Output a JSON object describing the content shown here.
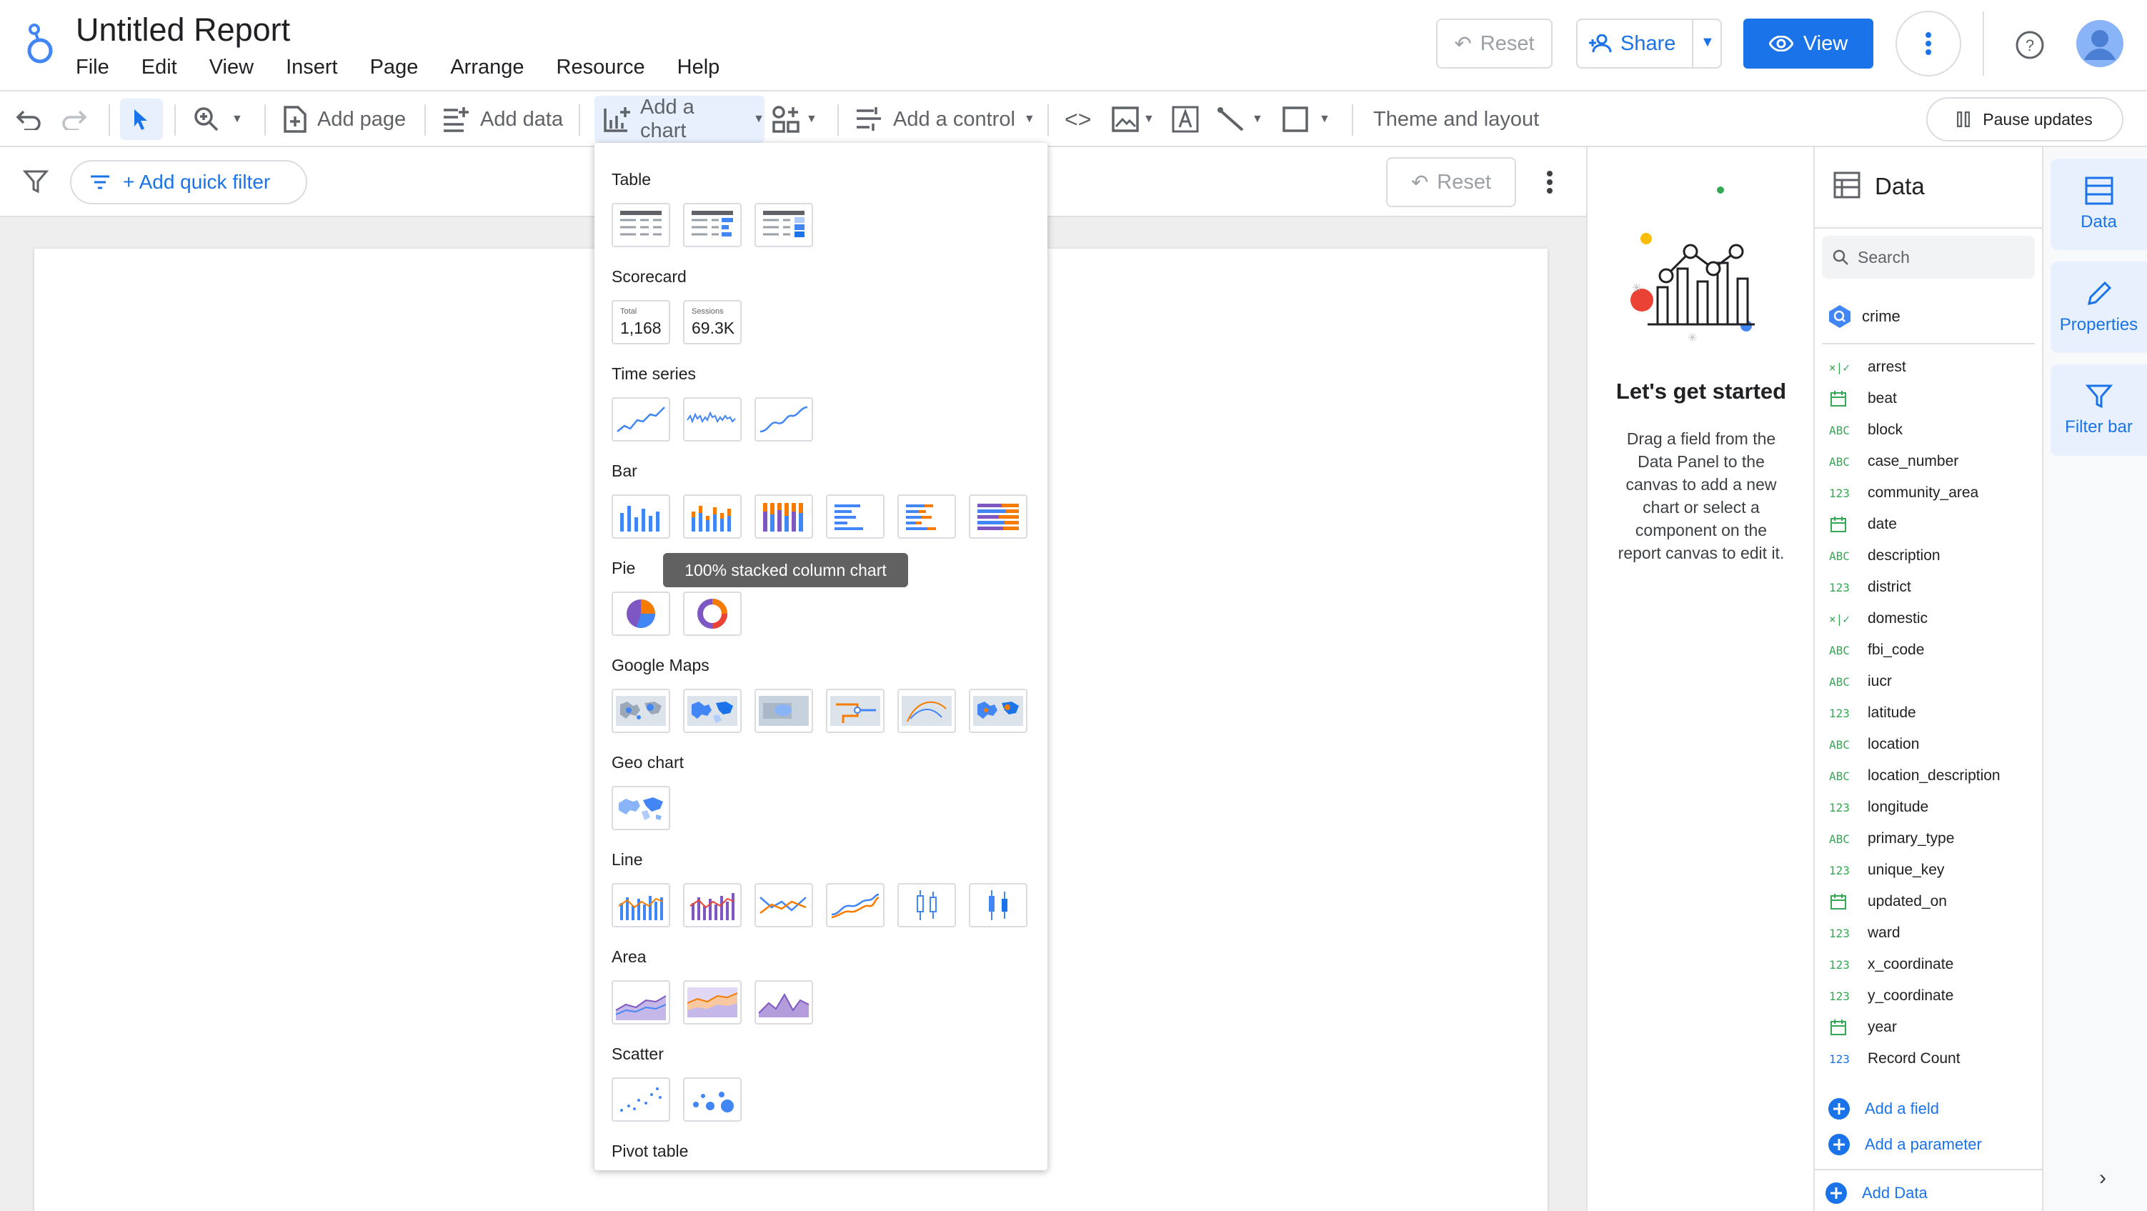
{
  "app": {
    "title": "Untitled Report"
  },
  "menu": [
    "File",
    "Edit",
    "View",
    "Insert",
    "Page",
    "Arrange",
    "Resource",
    "Help"
  ],
  "header_buttons": {
    "reset": "Reset",
    "share": "Share",
    "view": "View"
  },
  "toolbar": {
    "add_page": "Add page",
    "add_data": "Add data",
    "add_chart": "Add a chart",
    "add_control": "Add a control",
    "theme": "Theme and layout",
    "pause": "Pause updates"
  },
  "filterbar": {
    "quick_filter": "+ Add quick filter",
    "reset": "Reset"
  },
  "chart_menu": {
    "sections": {
      "table": "Table",
      "scorecard": "Scorecard",
      "time_series": "Time series",
      "bar": "Bar",
      "pie": "Pie",
      "google_maps": "Google Maps",
      "geo_chart": "Geo chart",
      "line": "Line",
      "area": "Area",
      "scatter": "Scatter",
      "pivot_table": "Pivot table"
    },
    "scorecard1": {
      "label": "Total",
      "value": "1,168"
    },
    "scorecard2": {
      "label": "Sessions",
      "value": "69.3K"
    },
    "tooltip": "100% stacked column chart"
  },
  "start_panel": {
    "heading": "Let's get started",
    "body": "Drag a field from the Data Panel to the canvas to add a new chart or select a component on the report canvas to edit it."
  },
  "data_panel": {
    "title": "Data",
    "search_placeholder": "Search",
    "source": "crime",
    "fields": [
      {
        "type": "×|✓",
        "name": "arrest"
      },
      {
        "type": "cal",
        "name": "beat"
      },
      {
        "type": "ABC",
        "name": "block"
      },
      {
        "type": "ABC",
        "name": "case_number"
      },
      {
        "type": "123",
        "name": "community_area"
      },
      {
        "type": "cal",
        "name": "date"
      },
      {
        "type": "ABC",
        "name": "description"
      },
      {
        "type": "123",
        "name": "district"
      },
      {
        "type": "×|✓",
        "name": "domestic"
      },
      {
        "type": "ABC",
        "name": "fbi_code"
      },
      {
        "type": "ABC",
        "name": "iucr"
      },
      {
        "type": "123",
        "name": "latitude"
      },
      {
        "type": "ABC",
        "name": "location"
      },
      {
        "type": "ABC",
        "name": "location_description"
      },
      {
        "type": "123",
        "name": "longitude"
      },
      {
        "type": "ABC",
        "name": "primary_type"
      },
      {
        "type": "123",
        "name": "unique_key"
      },
      {
        "type": "cal",
        "name": "updated_on"
      },
      {
        "type": "123",
        "name": "ward"
      },
      {
        "type": "123",
        "name": "x_coordinate"
      },
      {
        "type": "123",
        "name": "y_coordinate"
      },
      {
        "type": "cal",
        "name": "year"
      },
      {
        "type": "123",
        "name": "Record Count"
      }
    ],
    "add_field": "Add a field",
    "add_parameter": "Add a parameter",
    "add_data": "Add Data"
  },
  "rail": {
    "data": "Data",
    "properties": "Properties",
    "filter_bar": "Filter bar"
  },
  "colors": {
    "accent": "#1a73e8",
    "orange": "#f57c00",
    "purple": "#7e57c2"
  }
}
